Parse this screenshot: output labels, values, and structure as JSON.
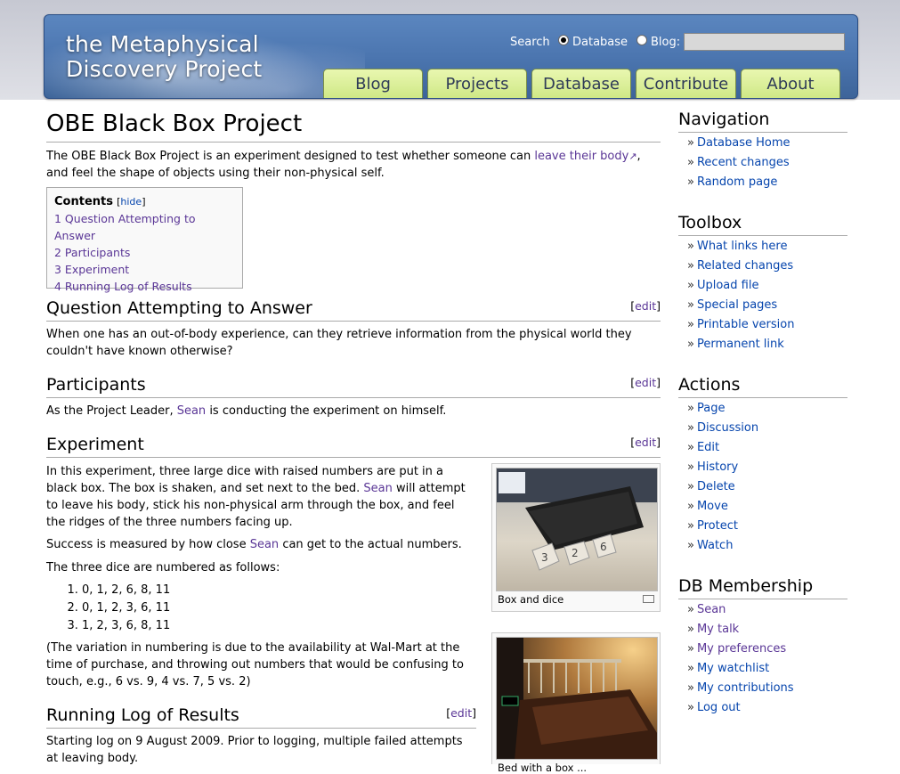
{
  "header": {
    "logo_line1": "the Metaphysical",
    "logo_line2": "Discovery Project",
    "search_label": "Search",
    "radio_database": "Database",
    "radio_blog": "Blog:",
    "search_value": "",
    "tabs": [
      "Blog",
      "Projects",
      "Database",
      "Contribute",
      "About"
    ]
  },
  "page": {
    "title": "OBE Black Box Project",
    "intro_pre": "The OBE Black Box Project is an experiment designed to test whether someone can ",
    "intro_link": "leave their body",
    "intro_post": ", and feel the shape of objects using their non-physical self.",
    "toc": {
      "title": "Contents",
      "hide": "hide",
      "items": [
        "1 Question Attempting to Answer",
        "2 Participants",
        "3 Experiment",
        "4 Running Log of Results"
      ]
    },
    "edit": "edit",
    "sections": {
      "question": {
        "heading": "Question Attempting to Answer",
        "text": "When one has an out-of-body experience, can they retrieve information from the physical world they couldn't have known otherwise?"
      },
      "participants": {
        "heading": "Participants",
        "pre": "As the Project Leader, ",
        "link": "Sean",
        "post": " is conducting the experiment on himself."
      },
      "experiment": {
        "heading": "Experiment",
        "p1_pre": "In this experiment, three large dice with raised numbers are put in a black box. The box is shaken, and set next to the bed. ",
        "p1_link": "Sean",
        "p1_post": " will attempt to leave his body, stick his non-physical arm through the box, and feel the ridges of the three numbers facing up.",
        "p2_pre": "Success is measured by how close ",
        "p2_link": "Sean",
        "p2_post": " can get to the actual numbers.",
        "p3": "The three dice are numbered as follows:",
        "dice": [
          "0, 1, 2, 6, 8, 11",
          "0, 1, 2, 3, 6, 11",
          "1, 2, 3, 6, 8, 11"
        ],
        "p4": "(The variation in numbering is due to the availability at Wal-Mart at the time of purchase, and throwing out numbers that would be confusing to touch, e.g., 6 vs. 9, 4 vs. 7, 5 vs. 2)",
        "caption1": "Box and dice",
        "caption2": "Bed with a box ..."
      },
      "log": {
        "heading": "Running Log of Results",
        "text": "Starting log on 9 August 2009. Prior to logging, multiple failed attempts at leaving body."
      }
    }
  },
  "sidebar": {
    "navigation": {
      "title": "Navigation",
      "items": [
        "Database Home",
        "Recent changes",
        "Random page"
      ]
    },
    "toolbox": {
      "title": "Toolbox",
      "items": [
        "What links here",
        "Related changes",
        "Upload file",
        "Special pages",
        "Printable version",
        "Permanent link"
      ]
    },
    "actions": {
      "title": "Actions",
      "items": [
        "Page",
        "Discussion",
        "Edit",
        "History",
        "Delete",
        "Move",
        "Protect",
        "Watch"
      ]
    },
    "membership": {
      "title": "DB Membership",
      "items": [
        "Sean",
        "My talk",
        "My preferences",
        "My watchlist",
        "My contributions",
        "Log out"
      ]
    }
  },
  "colors": {
    "link": "#5a3696",
    "link_blue": "#0645ad",
    "header_blue": "#4a74ae",
    "tab_green": "#d9ee98"
  }
}
